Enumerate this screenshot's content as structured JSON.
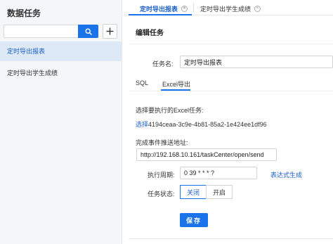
{
  "sidebar": {
    "title": "数据任务",
    "search_placeholder": "",
    "items": [
      {
        "label": "定时导出报表",
        "active": true
      },
      {
        "label": "定时导出学生成绩",
        "active": false
      }
    ]
  },
  "tabs": [
    {
      "label": "定时导出报表",
      "active": true
    },
    {
      "label": "定时导出学生成绩",
      "active": false
    }
  ],
  "panel": {
    "title": "编辑任务",
    "task_name_label": "任务名:",
    "task_name_value": "定时导出报表",
    "subtabs": [
      {
        "label": "SQL",
        "active": false
      },
      {
        "label": "Excel导出",
        "active": true
      }
    ],
    "excel_task_label": "选择要执行的Excel任务:",
    "select_link": "选择",
    "excel_task_id": "4194ceaa-3c9e-4b81-85a2-1e424ee1df96",
    "callback_label": "完成事件推送地址:",
    "callback_value": "http://192.168.10.161/taskCenter/open/send",
    "period_label": "执行周期:",
    "period_value": "0 39 * * * ?",
    "expression_link": "表达式生成",
    "status_label": "任务状态:",
    "status_options": [
      {
        "label": "关闭",
        "active": true
      },
      {
        "label": "开启",
        "active": false
      }
    ],
    "save_label": "保存"
  },
  "colors": {
    "accent": "#1a73e8",
    "sidebar_bg": "#f5f6f8",
    "active_item_bg": "#dde9f7"
  }
}
